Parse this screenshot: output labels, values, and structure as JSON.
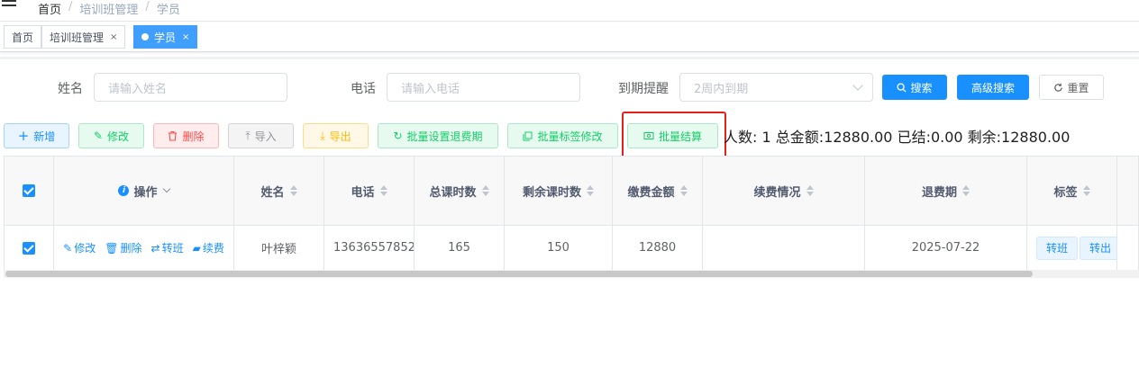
{
  "breadcrumb": [
    "首页",
    "培训班管理",
    "学员"
  ],
  "tags": [
    {
      "label": "首页",
      "active": false
    },
    {
      "label": "培训班管理",
      "active": false
    },
    {
      "label": "学员",
      "active": true
    }
  ],
  "form": {
    "name_label": "姓名",
    "name_placeholder": "请输入姓名",
    "phone_label": "电话",
    "phone_placeholder": "请输入电话",
    "expiry_label": "到期提醒",
    "expiry_value": "2周内到期",
    "search_btn": "搜索",
    "advanced_btn": "高级搜索",
    "reset_btn": "重置"
  },
  "toolbar": {
    "add": "新增",
    "edit": "修改",
    "delete": "删除",
    "import": "导入",
    "export": "导出",
    "batch_refund": "批量设置退费期",
    "batch_tag": "批量标签修改",
    "batch_settle": "批量结算"
  },
  "summary": "人数: 1 总金额:12880.00 已结:0.00 剩余:12880.00",
  "table": {
    "headers": {
      "ops": "操作",
      "name": "姓名",
      "phone": "电话",
      "total": "总课时数",
      "remain": "剩余课时数",
      "paid": "缴费金额",
      "renew": "续费情况",
      "refund": "退费期",
      "tags": "标签"
    },
    "row": {
      "op_edit": "修改",
      "op_delete": "删除",
      "op_transfer": "转班",
      "op_renew": "续费",
      "name": "叶梓颖",
      "phone": "13636557852",
      "total": "165",
      "remain": "150",
      "paid": "12880",
      "renew": "",
      "refund": "2025-07-22",
      "tag1": "转班",
      "tag2": "转出"
    }
  }
}
